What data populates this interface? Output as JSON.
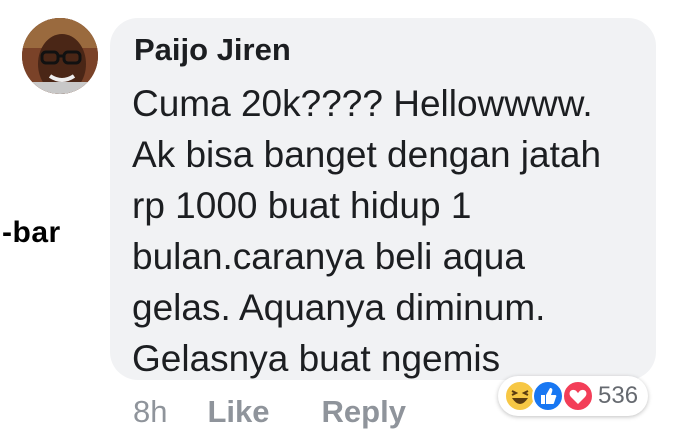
{
  "side_label": "-bar",
  "comment": {
    "author": "Paijo Jiren",
    "lines": [
      "Cuma 20k???? Hellowwww.",
      "Ak bisa banget dengan jatah",
      "rp 1000 buat hidup 1",
      "bulan.caranya beli aqua",
      "gelas. Aquanya diminum.",
      "Gelasnya buat ngemis"
    ],
    "time": "8h",
    "like_label": "Like",
    "reply_label": "Reply",
    "reactions": {
      "icons": [
        "haha-icon",
        "like-icon",
        "love-icon"
      ],
      "count": "536"
    }
  }
}
